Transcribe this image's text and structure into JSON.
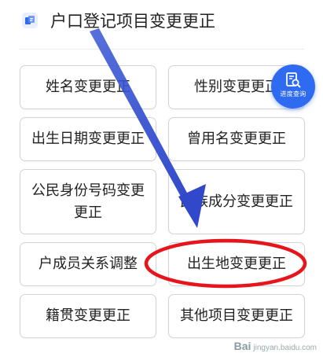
{
  "header": {
    "title": "户口登记项目变更更正",
    "icon": "document-edit-icon",
    "accent": "#2f6bf1"
  },
  "buttons": [
    {
      "id": "name",
      "label": "姓名变更更正"
    },
    {
      "id": "gender",
      "label": "性别变更更正"
    },
    {
      "id": "birthdate",
      "label": "出生日期变更更正"
    },
    {
      "id": "former-name",
      "label": "曾用名变更更正"
    },
    {
      "id": "id-number",
      "label": "公民身份号码变更更正"
    },
    {
      "id": "ethnicity",
      "label": "民族成分变更更正"
    },
    {
      "id": "relationship",
      "label": "户成员关系调整"
    },
    {
      "id": "birthplace",
      "label": "出生地变更更正"
    },
    {
      "id": "native-place",
      "label": "籍贯变更更正"
    },
    {
      "id": "other",
      "label": "其他项目变更更正"
    }
  ],
  "progress_button": {
    "label": "进度查询",
    "icon": "search-document-icon",
    "color": "#2f6bf1"
  },
  "annotation": {
    "arrow_color": "#3a57d6",
    "circle_color": "#e8141b"
  },
  "watermark": {
    "logo": "Bai",
    "text": "jingyan.baidu.com"
  }
}
